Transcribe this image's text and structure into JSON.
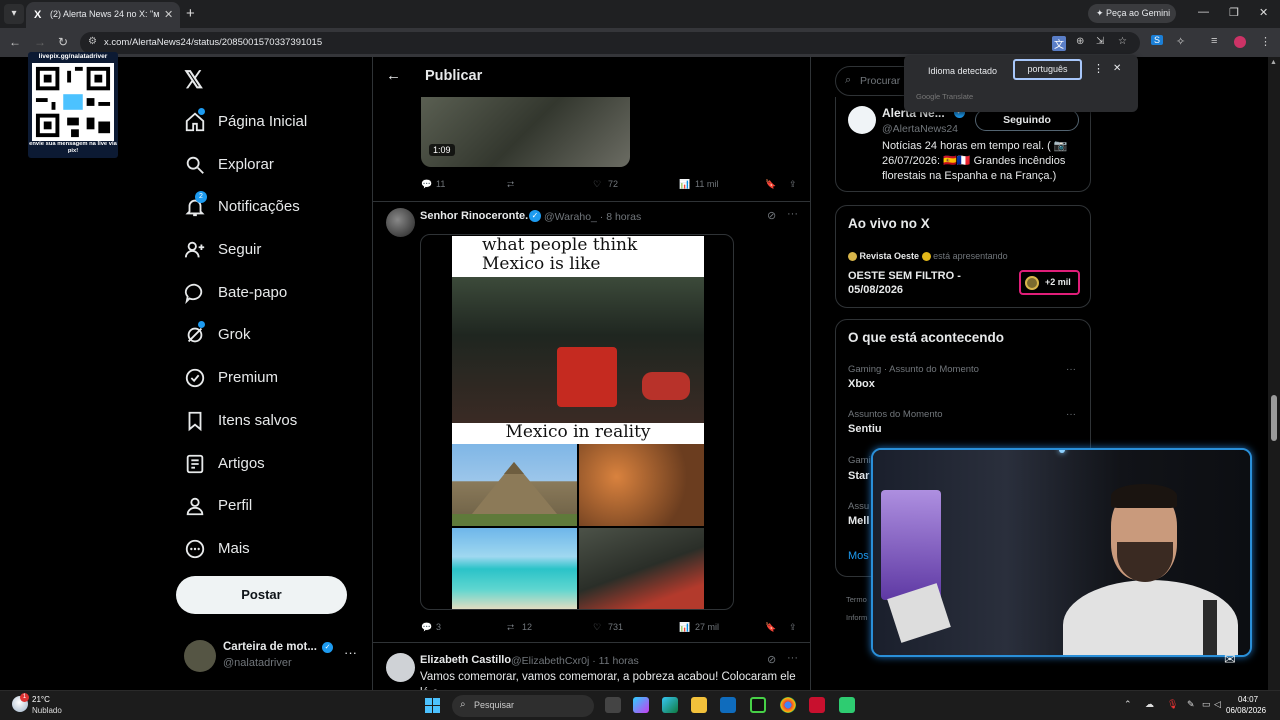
{
  "browser": {
    "tab_title": "(2) Alerta News 24 no X: \"мк | C",
    "tab_favicon": "X",
    "gemini_label": "✦ Peça ao Gemini",
    "url": "x.com/AlertaNews24/status/2085001570337391015"
  },
  "overlay_qr": {
    "url": "livepix.gg/nalatadriver",
    "caption": "envie sua mensagem na live via pix!"
  },
  "nav": {
    "logo": "𝕏",
    "items": [
      {
        "label": "Página Inicial",
        "icon": "home-icon"
      },
      {
        "label": "Explorar",
        "icon": "search-icon"
      },
      {
        "label": "Notificações",
        "icon": "bell-icon",
        "badge": "2"
      },
      {
        "label": "Seguir",
        "icon": "follow-icon"
      },
      {
        "label": "Bate-papo",
        "icon": "chat-icon"
      },
      {
        "label": "Grok",
        "icon": "grok-icon"
      },
      {
        "label": "Premium",
        "icon": "premium-icon"
      },
      {
        "label": "Itens salvos",
        "icon": "bookmark-icon"
      },
      {
        "label": "Artigos",
        "icon": "articles-icon"
      },
      {
        "label": "Perfil",
        "icon": "profile-icon"
      },
      {
        "label": "Mais",
        "icon": "more-icon"
      }
    ],
    "post_button": "Postar",
    "account": {
      "name": "Carteira de mot...",
      "handle": "@nalatadriver"
    }
  },
  "header": {
    "title": "Publicar"
  },
  "prev_post": {
    "duration": "1:09",
    "replies": "11",
    "likes": "72",
    "views": "11 mil"
  },
  "tweet": {
    "name": "Senhor Rinoceronte.",
    "handle_time": "@Waraho_ · 8 horas",
    "meme_top": "what people think Mexico is like",
    "meme_mid": "Mexico in reality",
    "replies": "3",
    "retweets": "12",
    "likes": "731",
    "views": "27 mil"
  },
  "tweet2": {
    "name": "Elizabeth Castillo",
    "handle_time": "@ElizabethCxr0j · 11 horas",
    "text": "Vamos comemorar, vamos comemorar, a pobreza acabou! Colocaram ele lá e"
  },
  "search": {
    "placeholder": "Procurar"
  },
  "account_panel": {
    "name": "Alerta Ne...",
    "handle": "@AlertaNews24",
    "follow_label": "Seguindo",
    "bio": "Notícias 24 horas em tempo real. ( 📷 26/07/2026: 🇪🇸🇫🇷 Grandes incêndios florestais na Espanha e na França.)"
  },
  "live_panel": {
    "title": "Ao vivo no X",
    "host": "Revista Oeste",
    "presenting": "está apresentando",
    "show_title": "OESTE SEM FILTRO - 05/08/2026",
    "count": "+2 mil"
  },
  "trends_panel": {
    "title": "O que está acontecendo",
    "items": [
      {
        "category": "Gaming · Assunto do Momento",
        "name": "Xbox"
      },
      {
        "category": "Assuntos do Momento",
        "name": "Sentiu"
      },
      {
        "category": "Gami",
        "name": "Star"
      },
      {
        "category": "Assu",
        "name": "Mell"
      }
    ],
    "more_link": "Mos"
  },
  "footer_links": [
    "Termo",
    "Inform"
  ],
  "translate": {
    "detected": "Idioma detectado",
    "selected": "português",
    "brand": "Google Translate"
  },
  "taskbar": {
    "temp": "21°C",
    "condition": "Nublado",
    "weather_badge": "1",
    "search_text": "Pesquisar",
    "time": "04:07",
    "date": "06/08/2026"
  },
  "colors": {
    "accent": "#1d9bf0",
    "live_border": "#e01e79",
    "post_button_bg": "#eff3f4"
  }
}
